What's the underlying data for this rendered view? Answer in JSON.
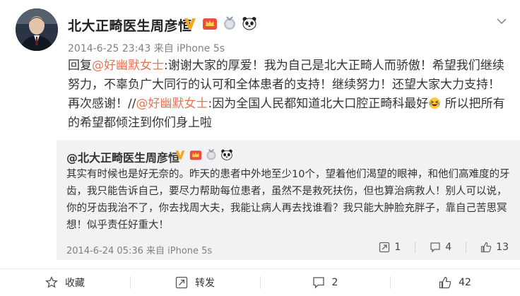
{
  "post": {
    "username": "北大正畸医生周彦恒",
    "timestamp": "2014-6-25 23:43",
    "source": "来自 iPhone 5s",
    "text": {
      "reply_prefix": "回复",
      "mention1": "@好幽默女士",
      "part1": ":谢谢大家的厚爱！我为自己是北大正畸人而骄傲！希望我们继续努力，不辜负广大同行的认可和全体患者的支持！继续努力！还望大家大力支持！再次感谢！//",
      "mention2": "@好幽默女士",
      "part2": ":因为全国人民都知道北大口腔正畸科最好",
      "part3": " 所以把所有的希望都倾注到你们身上啦"
    }
  },
  "quoted": {
    "username": "@北大正畸医生周彦恒",
    "text": "其实有时候也是好无奈的。昨天的患者中外地至少10个，望着他们渴望的眼神，和他们高难度的牙齿，我只能告诉自己，要尽力帮助每位患者，虽然不是救死扶伤，但也算治病救人！别人可以说，你的牙齿我治不了，你去找周大夫，我能让病人再去找谁看？我只能大肿脸充胖子，靠自己苦思冥想！似乎责任好重大！",
    "timestamp": "2014-6-24 05:36",
    "source": "来自 iPhone 5s",
    "repost_count": "1",
    "comment_count": "4",
    "like_count": "13"
  },
  "actions": {
    "favorite": "收藏",
    "repost": "转发",
    "comment_count": "2",
    "like_count": "42"
  },
  "colors": {
    "mention": "#eb7350",
    "verified": "#f5a623",
    "meta": "#808080",
    "quote_bg": "#f2f2f5"
  },
  "icons": {
    "verified": "verified-v-icon",
    "member": "crown-member-icon",
    "medal": "medal-icon",
    "panda": "panda-icon",
    "chevron": "chevron-down-icon",
    "emoji": "laughing-tears-emoji"
  }
}
